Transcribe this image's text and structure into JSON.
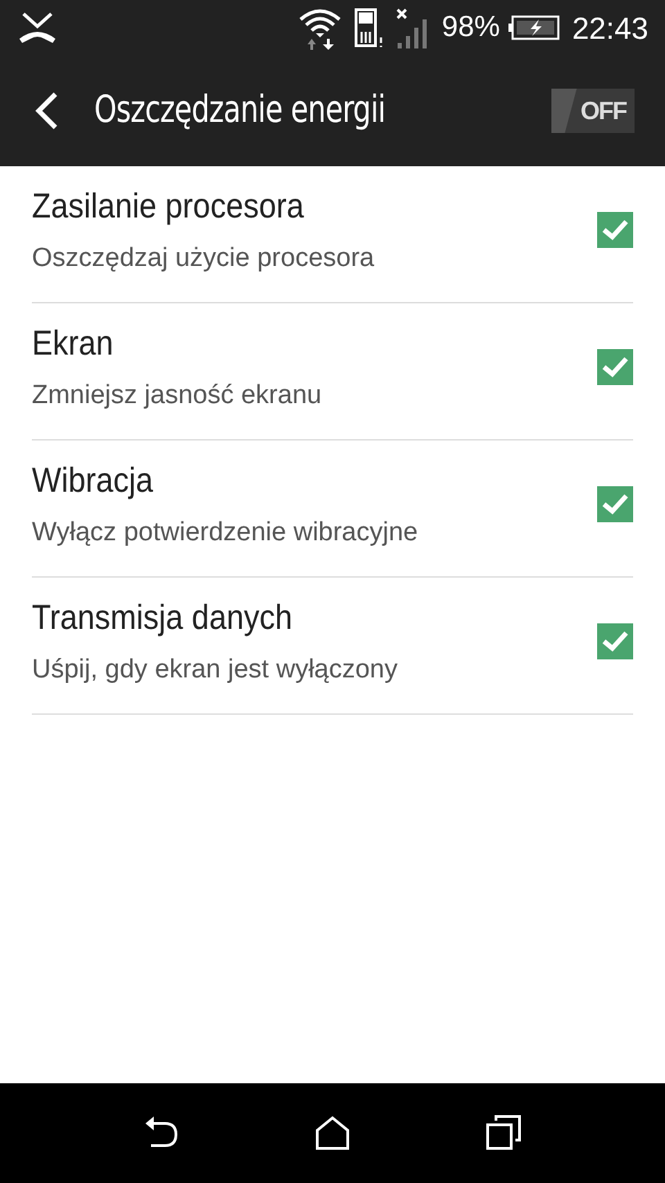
{
  "status_bar": {
    "battery": "98%",
    "time": "22:43"
  },
  "header": {
    "title": "Oszczędzanie energii",
    "toggle": {
      "label": "OFF",
      "on": false
    }
  },
  "settings": [
    {
      "title": "Zasilanie procesora",
      "subtitle": "Oszczędzaj użycie procesora",
      "checked": true
    },
    {
      "title": "Ekran",
      "subtitle": "Zmniejsz jasność ekranu",
      "checked": true
    },
    {
      "title": "Wibracja",
      "subtitle": "Wyłącz potwierdzenie wibracyjne",
      "checked": true
    },
    {
      "title": "Transmisja danych",
      "subtitle": "Uśpij, gdy ekran jest wyłączony",
      "checked": true
    }
  ]
}
